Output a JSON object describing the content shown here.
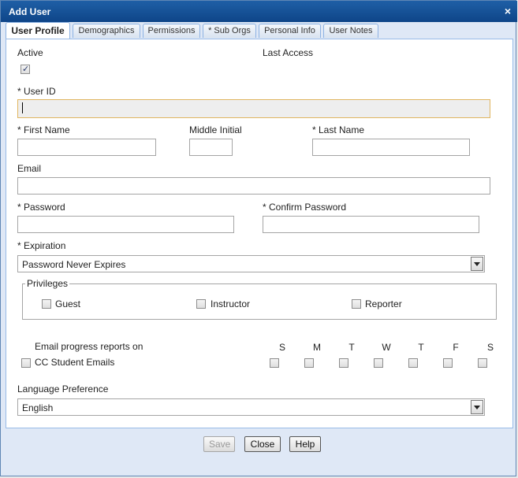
{
  "dialog": {
    "title": "Add User",
    "close_glyph": "×"
  },
  "tabs": [
    {
      "label": "User Profile",
      "active": true
    },
    {
      "label": "Demographics",
      "active": false
    },
    {
      "label": "Permissions",
      "active": false
    },
    {
      "label": "* Sub Orgs",
      "active": false
    },
    {
      "label": "Personal Info",
      "active": false
    },
    {
      "label": "User Notes",
      "active": false
    }
  ],
  "form": {
    "active_label": "Active",
    "active_checked": true,
    "last_access_label": "Last Access",
    "user_id_label": "* User ID",
    "user_id_value": "",
    "first_name_label": "* First Name",
    "middle_initial_label": "Middle Initial",
    "last_name_label": "* Last Name",
    "email_label": "Email",
    "password_label": "* Password",
    "confirm_password_label": "* Confirm Password",
    "expiration_label": "* Expiration",
    "expiration_value": "Password Never Expires",
    "privileges_label": "Privileges",
    "privileges": [
      {
        "label": "Guest",
        "checked": false
      },
      {
        "label": "Instructor",
        "checked": false
      },
      {
        "label": "Reporter",
        "checked": false
      }
    ],
    "email_progress_label": "Email progress reports on",
    "days": [
      "S",
      "M",
      "T",
      "W",
      "T",
      "F",
      "S"
    ],
    "cc_student_label": "CC Student Emails",
    "language_label": "Language Preference",
    "language_value": "English"
  },
  "footer": {
    "save_label": "Save",
    "close_label": "Close",
    "help_label": "Help"
  },
  "colors": {
    "titlebar": "#1f5fa6",
    "tab_border": "#8db2e3",
    "focus_border": "#e0b660"
  }
}
